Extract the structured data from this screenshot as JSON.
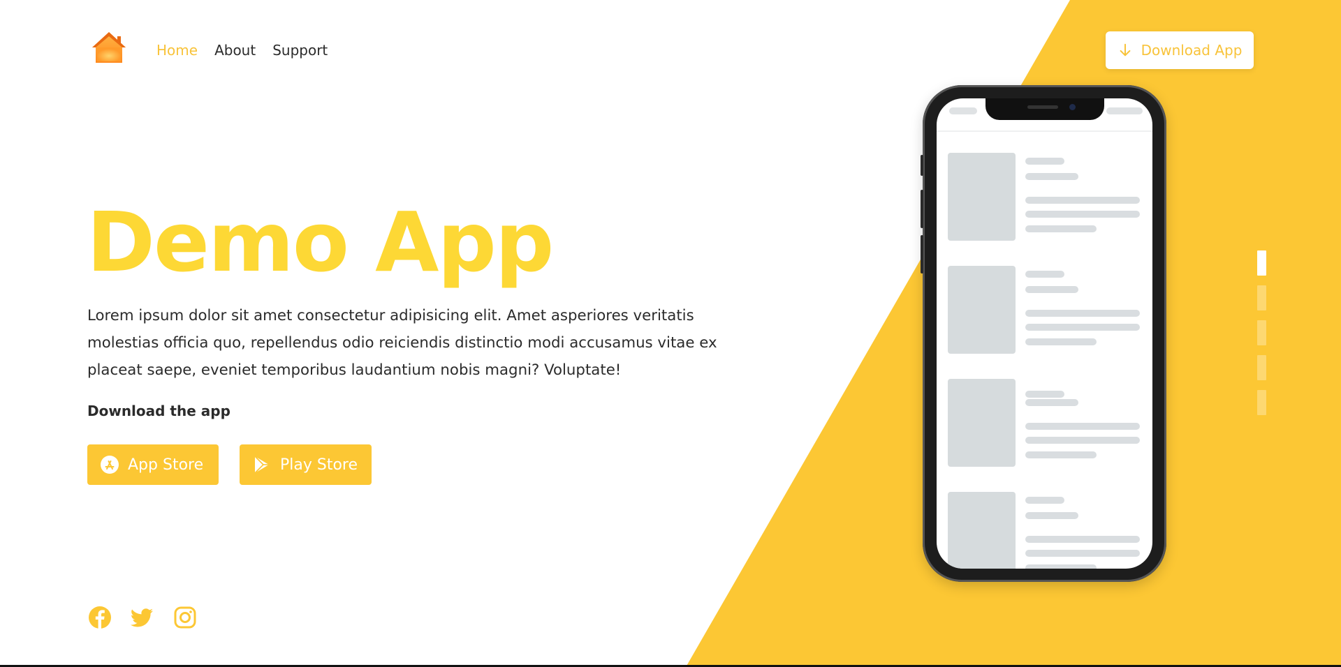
{
  "colors": {
    "accent": "#fcc734",
    "title": "#fdd835",
    "nav_active": "#f8c33a",
    "text": "#2b2b2b"
  },
  "nav": {
    "logo_icon": "house-icon",
    "items": [
      {
        "label": "Home",
        "active": true
      },
      {
        "label": "About",
        "active": false
      },
      {
        "label": "Support",
        "active": false
      }
    ]
  },
  "header": {
    "download_button": {
      "label": "Download App",
      "icon": "arrow-down-icon"
    }
  },
  "hero": {
    "title": "Demo App",
    "description": "Lorem ipsum dolor sit amet consectetur adipisicing elit. Amet asperiores veritatis molestias officia quo, repellendus odio reiciendis distinctio modi accusamus vitae ex placeat saepe, eveniet temporibus laudantium nobis magni? Voluptate!",
    "download_label": "Download the app",
    "store_buttons": [
      {
        "label": "App Store",
        "icon": "app-store-icon"
      },
      {
        "label": "Play Store",
        "icon": "play-store-icon"
      }
    ]
  },
  "social": [
    {
      "name": "facebook",
      "icon": "facebook-icon"
    },
    {
      "name": "twitter",
      "icon": "twitter-icon"
    },
    {
      "name": "instagram",
      "icon": "instagram-icon"
    }
  ],
  "pager": {
    "count": 5,
    "active_index": 0
  }
}
